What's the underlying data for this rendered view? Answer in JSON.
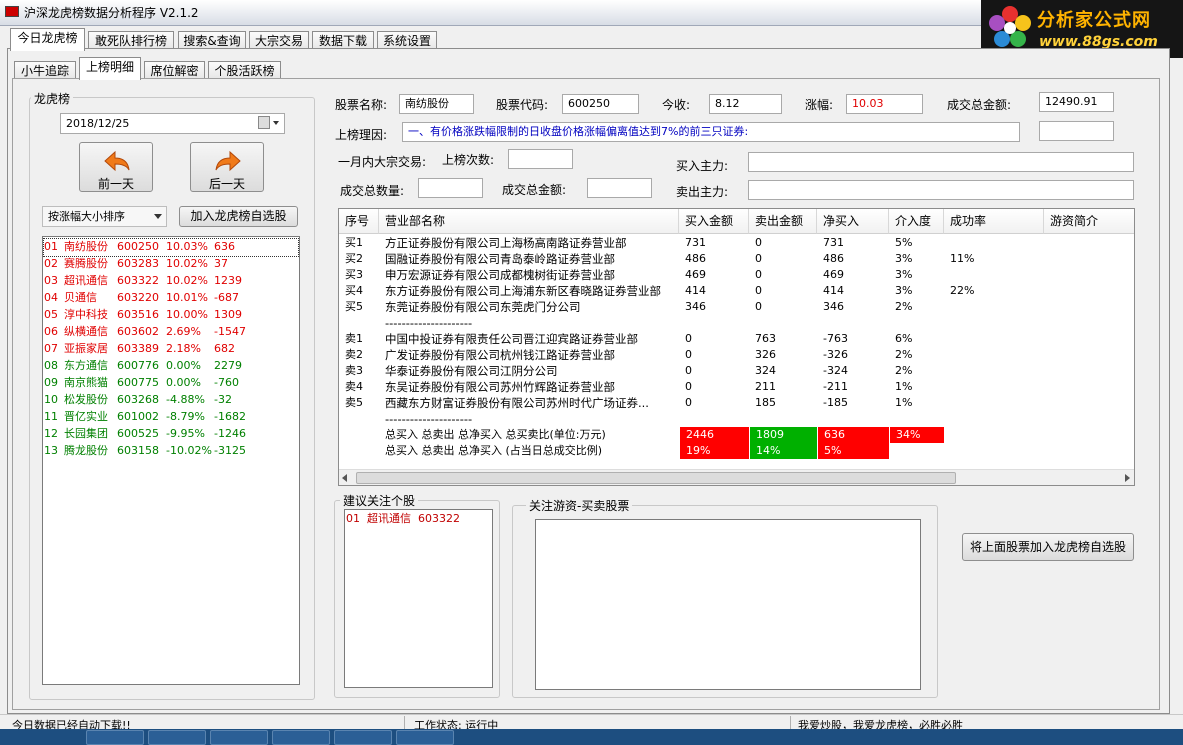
{
  "window": {
    "title": "沪深龙虎榜数据分析程序 V2.1.2"
  },
  "logo": {
    "cn": "分析家公式网",
    "url": "www.88gs.com"
  },
  "main_tabs": [
    "今日龙虎榜",
    "敢死队排行榜",
    "搜索&查询",
    "大宗交易",
    "数据下载",
    "系统设置"
  ],
  "sub_tabs": [
    "小牛追踪",
    "上榜明细",
    "席位解密",
    "个股活跃榜"
  ],
  "left": {
    "group_label": "龙虎榜",
    "date": "2018/12/25",
    "prev_label": "前一天",
    "next_label": "后一天",
    "sort": "按涨幅大小排序",
    "add_label": "加入龙虎榜自选股",
    "stocks": [
      {
        "no": "01",
        "name": "南纺股份",
        "code": "600250",
        "pct": "10.03%",
        "amt": "636",
        "color": "#e00000"
      },
      {
        "no": "02",
        "name": "赛腾股份",
        "code": "603283",
        "pct": "10.02%",
        "amt": "37",
        "color": "#e00000"
      },
      {
        "no": "03",
        "name": "超讯通信",
        "code": "603322",
        "pct": "10.02%",
        "amt": "1239",
        "color": "#e00000"
      },
      {
        "no": "04",
        "name": "贝通信",
        "code": "603220",
        "pct": "10.01%",
        "amt": "-687",
        "color": "#e00000"
      },
      {
        "no": "05",
        "name": "淳中科技",
        "code": "603516",
        "pct": "10.00%",
        "amt": "1309",
        "color": "#e00000"
      },
      {
        "no": "06",
        "name": "纵横通信",
        "code": "603602",
        "pct": "2.69%",
        "amt": "-1547",
        "color": "#e00000"
      },
      {
        "no": "07",
        "name": "亚振家居",
        "code": "603389",
        "pct": "2.18%",
        "amt": "682",
        "color": "#e00000"
      },
      {
        "no": "08",
        "name": "东方通信",
        "code": "600776",
        "pct": "0.00%",
        "amt": "2279",
        "color": "#008000"
      },
      {
        "no": "09",
        "name": "南京熊猫",
        "code": "600775",
        "pct": "0.00%",
        "amt": "-760",
        "color": "#008000"
      },
      {
        "no": "10",
        "name": "松发股份",
        "code": "603268",
        "pct": "-4.88%",
        "amt": "-32",
        "color": "#008000"
      },
      {
        "no": "11",
        "name": "晋亿实业",
        "code": "601002",
        "pct": "-8.79%",
        "amt": "-1682",
        "color": "#008000"
      },
      {
        "no": "12",
        "name": "长园集团",
        "code": "600525",
        "pct": "-9.95%",
        "amt": "-1246",
        "color": "#008000"
      },
      {
        "no": "13",
        "name": "腾龙股份",
        "code": "603158",
        "pct": "-10.02%",
        "amt": "-3125",
        "color": "#008000"
      }
    ]
  },
  "info": {
    "name_label": "股票名称:",
    "name": "南纺股份",
    "code_label": "股票代码:",
    "code": "600250",
    "close_label": "今收:",
    "close": "8.12",
    "chg_label": "涨幅:",
    "chg": "10.03",
    "turnover_label": "成交总金额:",
    "turnover": "12490.91",
    "reason_label": "上榜理因:",
    "reason": "一、有价格涨跌幅限制的日收盘价格涨幅偏离值达到7%的前三只证券:",
    "block_label": "一月内大宗交易:",
    "times_label": "上榜次数:",
    "buy_main_label": "买入主力:",
    "vol_label": "成交总数量:",
    "amt_label": "成交总金额:",
    "sell_main_label": "卖出主力:"
  },
  "grid": {
    "headers": [
      "序号",
      "营业部名称",
      "买入金额",
      "卖出金额",
      "净买入",
      "介入度",
      "成功率",
      "游资简介"
    ],
    "rows": [
      [
        "买1",
        "方正证券股份有限公司上海杨高南路证券营业部",
        "731",
        "0",
        "731",
        "5%",
        ""
      ],
      [
        "买2",
        "国融证券股份有限公司青岛泰岭路证券营业部",
        "486",
        "0",
        "486",
        "3%",
        "11%"
      ],
      [
        "买3",
        "申万宏源证券有限公司成都槐树街证券营业部",
        "469",
        "0",
        "469",
        "3%",
        ""
      ],
      [
        "买4",
        "东方证券股份有限公司上海浦东新区春晓路证券营业部",
        "414",
        "0",
        "414",
        "3%",
        "22%"
      ],
      [
        "买5",
        "东莞证券股份有限公司东莞虎门分公司",
        "346",
        "0",
        "346",
        "2%",
        ""
      ],
      [
        "",
        "---------------------",
        "",
        "",
        "",
        "",
        ""
      ],
      [
        "卖1",
        "中国中投证券有限责任公司晋江迎宾路证券营业部",
        "0",
        "763",
        "-763",
        "6%",
        ""
      ],
      [
        "卖2",
        "广发证券股份有限公司杭州钱江路证券营业部",
        "0",
        "326",
        "-326",
        "2%",
        ""
      ],
      [
        "卖3",
        "华泰证券股份有限公司江阴分公司",
        "0",
        "324",
        "-324",
        "2%",
        ""
      ],
      [
        "卖4",
        "东吴证券股份有限公司苏州竹辉路证券营业部",
        "0",
        "211",
        "-211",
        "1%",
        ""
      ],
      [
        "卖5",
        "西藏东方财富证券股份有限公司苏州时代广场证券...",
        "0",
        "185",
        "-185",
        "1%",
        ""
      ],
      [
        "",
        "---------------------",
        "",
        "",
        "",
        "",
        ""
      ]
    ],
    "summary1": {
      "label": "总买入  总卖出  总净买入  总买卖比(单位:万元)",
      "buy": "2446",
      "sell": "1809",
      "net": "636",
      "ratio": "34%"
    },
    "summary2": {
      "label": "总买入  总卖出  总净买入  (占当日总成交比例)",
      "buy": "19%",
      "sell": "14%",
      "net": "5%"
    }
  },
  "suggest": {
    "label": "建议关注个股",
    "item": "01  超讯通信  603322"
  },
  "hot": {
    "label": "关注游资-买卖股票"
  },
  "add_above_label": "将上面股票加入龙虎榜自选股",
  "status": {
    "left": "今日数据已经自动下载!!",
    "mid": "工作状态: 运行中",
    "right": "我爱炒股，我爱龙虎榜，必胜必胜"
  },
  "colors": {
    "red": "#e00000",
    "green": "#008000",
    "cell_red": "#ff0000",
    "cell_green": "#00b000"
  }
}
